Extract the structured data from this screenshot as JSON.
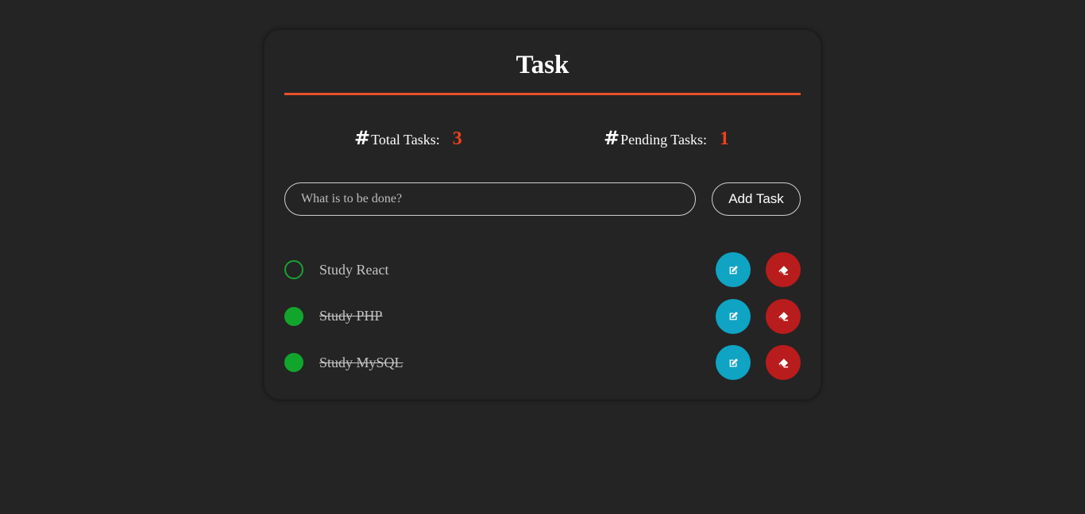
{
  "app": {
    "title": "Task"
  },
  "colors": {
    "accent": "#e8502a",
    "count": "#f0401e",
    "done_check": "#12a52c",
    "edit_button": "#0fa3c4",
    "delete_button": "#b91c1c",
    "background": "#242424"
  },
  "stats": {
    "hash": "#",
    "total_label": "Total Tasks:",
    "total_value": "3",
    "pending_label": "Pending Tasks:",
    "pending_value": "1"
  },
  "add_task": {
    "placeholder": "What is to be done?",
    "value": "",
    "button_label": "Add Task"
  },
  "tasks": [
    {
      "text": "Study React",
      "completed": false,
      "edit_icon": "edit-icon",
      "delete_icon": "eraser-icon"
    },
    {
      "text": "Study PHP",
      "completed": true,
      "edit_icon": "edit-icon",
      "delete_icon": "eraser-icon"
    },
    {
      "text": "Study MySQL",
      "completed": true,
      "edit_icon": "edit-icon",
      "delete_icon": "eraser-icon"
    }
  ]
}
